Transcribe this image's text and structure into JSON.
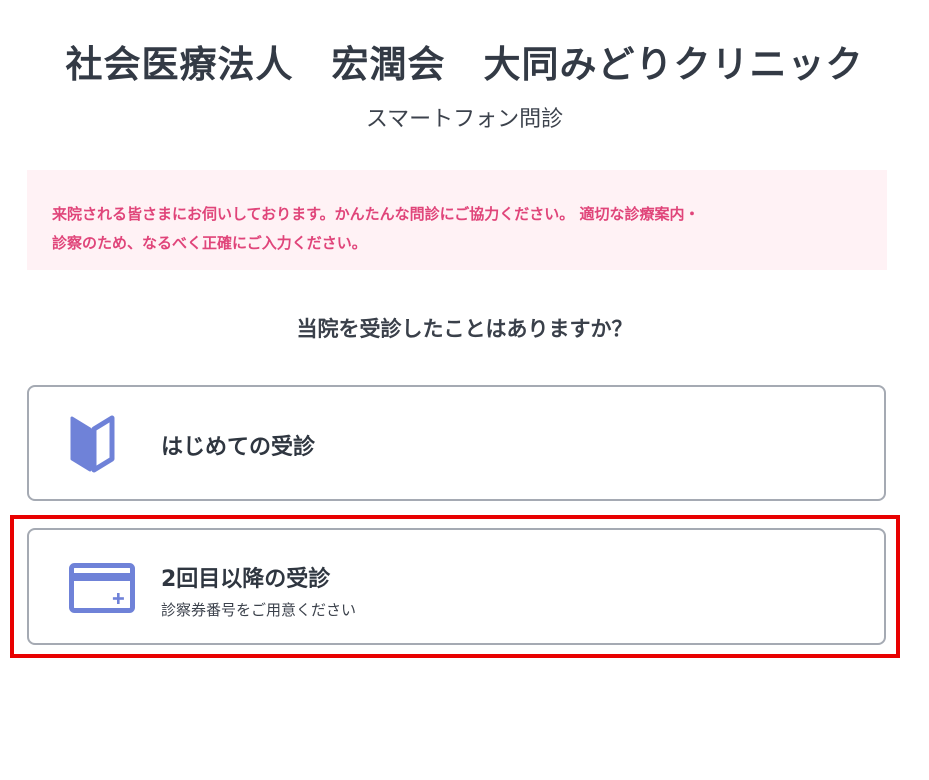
{
  "header": {
    "clinic_name": "社会医療法人　宏潤会　大同みどりクリニック",
    "subtitle": "スマートフォン問診"
  },
  "notice": {
    "line1": "来院される皆さまにお伺いしております。かんたんな問診にご協力ください。 適切な診療案内・",
    "line2": "診察のため、なるべく正確にご入力ください。"
  },
  "question": {
    "text": "当院を受診したことはありますか？"
  },
  "options": [
    {
      "label": "はじめての受診",
      "icon": "beginner-mark-icon"
    },
    {
      "label": "2回目以降の受診",
      "sublabel": "診察券番号をご用意ください",
      "icon": "card-icon"
    }
  ],
  "colors": {
    "accent_icon": "#6f82d8",
    "notice_text": "#e0457a",
    "notice_bg": "#fff2f5",
    "highlight": "#e80000",
    "border": "#a5aab3"
  }
}
